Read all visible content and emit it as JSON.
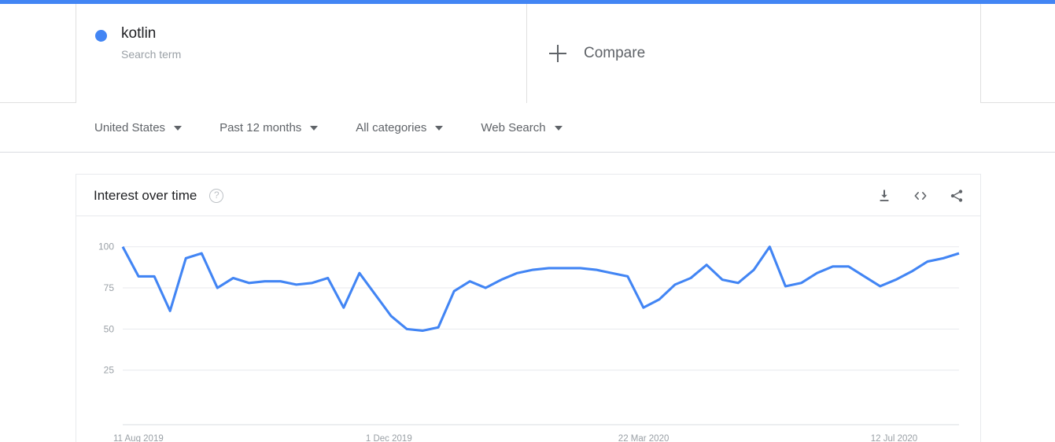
{
  "theme": {
    "accent": "#4285f4",
    "series_color": "#4285f4",
    "page_bg": "#f5f5f5",
    "text_primary": "#202124",
    "text_secondary": "#5f6368",
    "text_muted": "#9aa0a6"
  },
  "terms": [
    {
      "label": "kotlin",
      "type_label": "Search term",
      "color": "#4285f4"
    }
  ],
  "compare": {
    "label": "Compare",
    "icon": "plus-icon"
  },
  "filters": [
    {
      "name": "location",
      "value": "United States"
    },
    {
      "name": "time-range",
      "value": "Past 12 months"
    },
    {
      "name": "category",
      "value": "All categories"
    },
    {
      "name": "search-type",
      "value": "Web Search"
    }
  ],
  "card": {
    "title": "Interest over time",
    "help_icon": "help-circle-icon",
    "actions": [
      {
        "name": "download-csv",
        "icon": "download-icon"
      },
      {
        "name": "embed-code",
        "icon": "code-brackets-icon"
      },
      {
        "name": "share",
        "icon": "share-icon"
      }
    ]
  },
  "chart_data": {
    "type": "line",
    "title": "Interest over time",
    "xlabel": "",
    "ylabel": "",
    "ylim": [
      0,
      108
    ],
    "yticks": [
      25,
      50,
      75,
      100
    ],
    "ytick_labels": [
      "25",
      "50",
      "75",
      "100"
    ],
    "grid": true,
    "legend": "none",
    "xticks_positions": [
      0,
      16,
      32,
      48
    ],
    "xtick_labels": [
      "11 Aug 2019",
      "1 Dec 2019",
      "22 Mar 2020",
      "12 Jul 2020"
    ],
    "x": [
      "11 Aug 2019",
      "18 Aug 2019",
      "25 Aug 2019",
      "1 Sep 2019",
      "8 Sep 2019",
      "15 Sep 2019",
      "22 Sep 2019",
      "29 Sep 2019",
      "6 Oct 2019",
      "13 Oct 2019",
      "20 Oct 2019",
      "27 Oct 2019",
      "3 Nov 2019",
      "10 Nov 2019",
      "17 Nov 2019",
      "24 Nov 2019",
      "1 Dec 2019",
      "8 Dec 2019",
      "15 Dec 2019",
      "22 Dec 2019",
      "29 Dec 2019",
      "5 Jan 2020",
      "12 Jan 2020",
      "19 Jan 2020",
      "26 Jan 2020",
      "2 Feb 2020",
      "9 Feb 2020",
      "16 Feb 2020",
      "23 Feb 2020",
      "1 Mar 2020",
      "8 Mar 2020",
      "15 Mar 2020",
      "22 Mar 2020",
      "29 Mar 2020",
      "5 Apr 2020",
      "12 Apr 2020",
      "19 Apr 2020",
      "26 Apr 2020",
      "3 May 2020",
      "10 May 2020",
      "17 May 2020",
      "24 May 2020",
      "31 May 2020",
      "7 Jun 2020",
      "14 Jun 2020",
      "21 Jun 2020",
      "28 Jun 2020",
      "5 Jul 2020",
      "12 Jul 2020",
      "19 Jul 2020",
      "26 Jul 2020",
      "2 Aug 2020"
    ],
    "series": [
      {
        "name": "kotlin",
        "color": "#4285f4",
        "values": [
          100,
          82,
          82,
          61,
          93,
          96,
          75,
          81,
          78,
          79,
          79,
          77,
          78,
          81,
          63,
          84,
          71,
          58,
          50,
          49,
          51,
          73,
          79,
          75,
          80,
          84,
          86,
          87,
          87,
          87,
          86,
          84,
          82,
          63,
          68,
          77,
          81,
          89,
          80,
          78,
          86,
          100,
          76,
          78,
          84,
          88,
          88,
          82,
          76,
          80,
          85,
          91,
          93,
          96
        ]
      }
    ]
  }
}
